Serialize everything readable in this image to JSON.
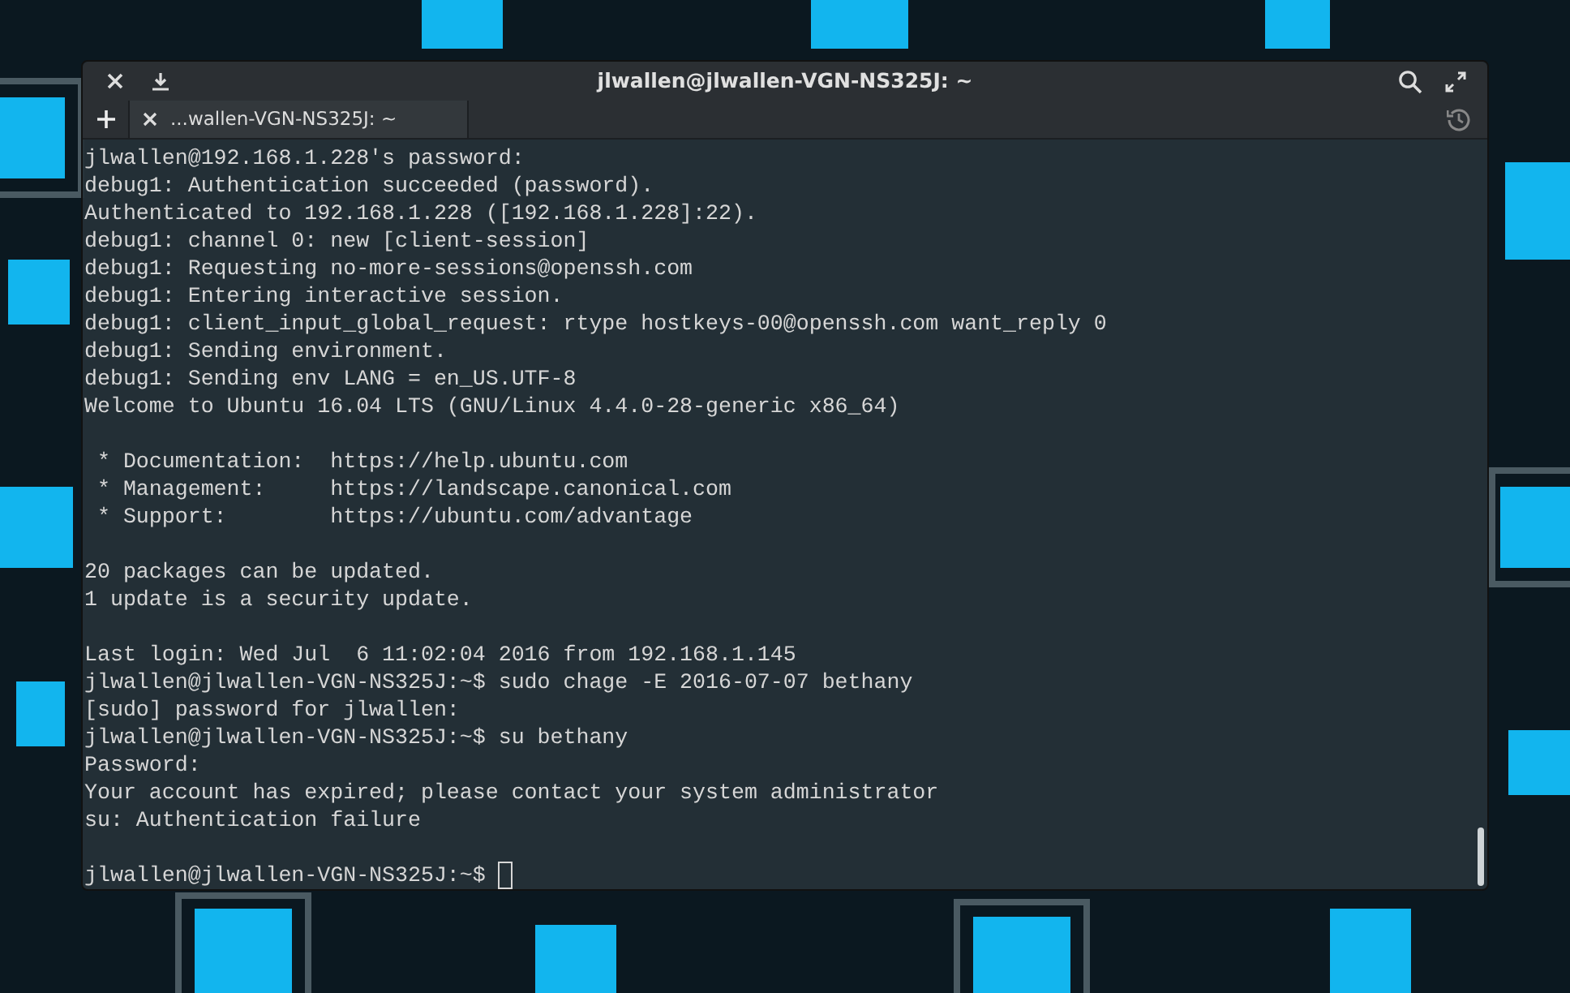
{
  "window": {
    "title": "jlwallen@jlwallen-VGN-NS325J: ~"
  },
  "tabs": [
    {
      "label": "...wallen-VGN-NS325J: ~",
      "selected": true
    }
  ],
  "terminal": {
    "blocks": [
      [
        "jlwallen@192.168.1.228's password:",
        "debug1: Authentication succeeded (password).",
        "Authenticated to 192.168.1.228 ([192.168.1.228]:22).",
        "debug1: channel 0: new [client-session]",
        "debug1: Requesting no-more-sessions@openssh.com",
        "debug1: Entering interactive session.",
        "debug1: client_input_global_request: rtype hostkeys-00@openssh.com want_reply 0",
        "debug1: Sending environment.",
        "debug1: Sending env LANG = en_US.UTF-8",
        "Welcome to Ubuntu 16.04 LTS (GNU/Linux 4.4.0-28-generic x86_64)"
      ],
      [
        " * Documentation:  https://help.ubuntu.com",
        " * Management:     https://landscape.canonical.com",
        " * Support:        https://ubuntu.com/advantage"
      ],
      [
        "20 packages can be updated.",
        "1 update is a security update."
      ],
      [
        "Last login: Wed Jul  6 11:02:04 2016 from 192.168.1.145",
        "jlwallen@jlwallen-VGN-NS325J:~$ sudo chage -E 2016-07-07 bethany",
        "[sudo] password for jlwallen:",
        "jlwallen@jlwallen-VGN-NS325J:~$ su bethany",
        "Password:",
        "Your account has expired; please contact your system administrator",
        "su: Authentication failure"
      ]
    ],
    "prompt": "jlwallen@jlwallen-VGN-NS325J:~$"
  }
}
